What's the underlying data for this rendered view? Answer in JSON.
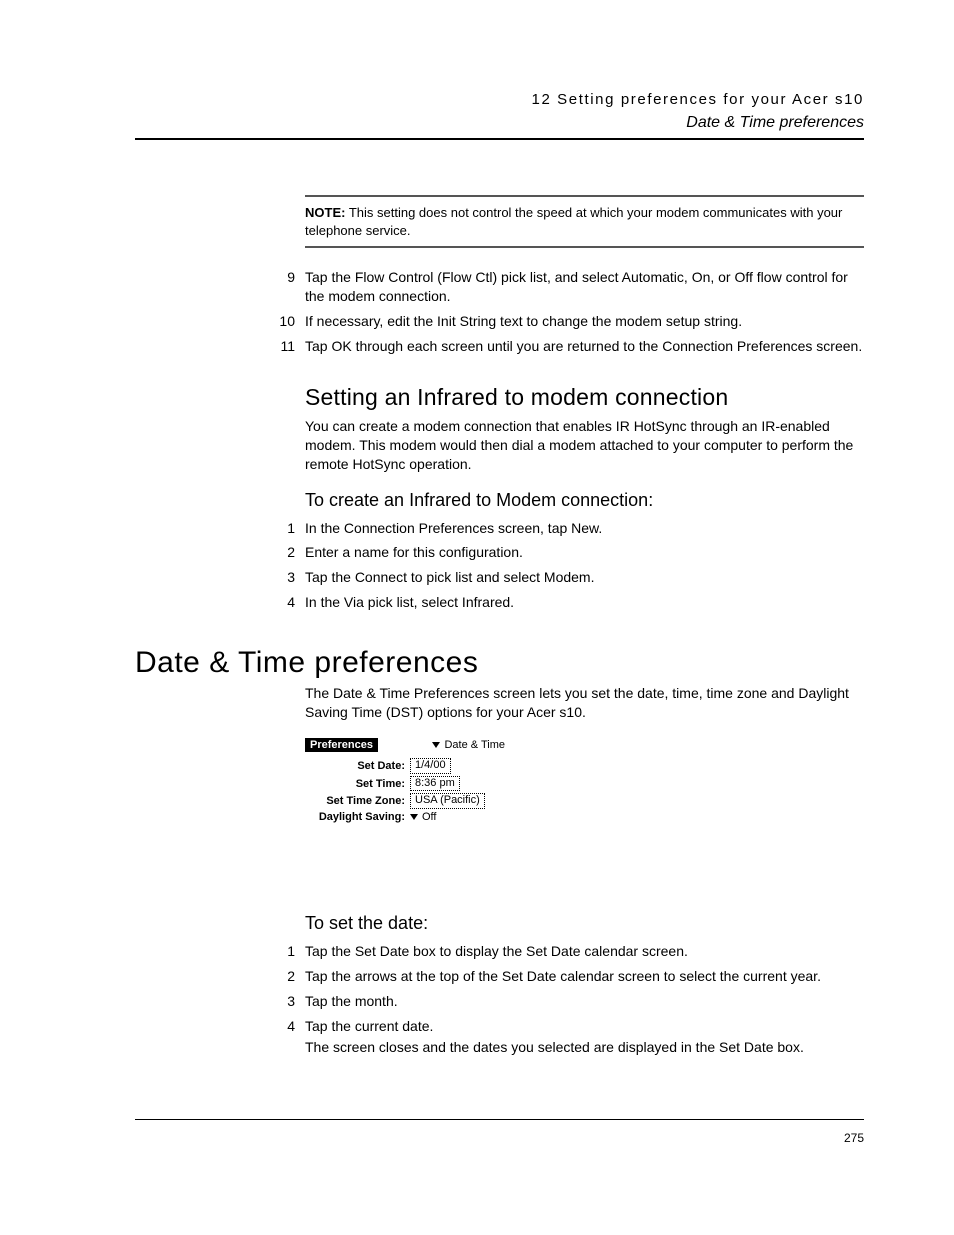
{
  "header": {
    "chapter": "12 Setting preferences for your Acer s10",
    "section": "Date & Time preferences"
  },
  "note": {
    "label": "NOTE:",
    "text": "This setting does not control the speed at which your modem communicates with your telephone service."
  },
  "steps_a": [
    {
      "n": "9",
      "text": "Tap the Flow Control (Flow Ctl) pick list, and select Automatic, On, or Off flow control for the modem connection."
    },
    {
      "n": "10",
      "text": "If necessary, edit the Init String text to change the modem setup string."
    },
    {
      "n": "11",
      "text": "Tap OK through each screen until you are returned to the Connection Preferences screen."
    }
  ],
  "sub1": {
    "title": "Setting an Infrared to modem connection",
    "para": "You can create a modem connection that enables IR HotSync through an IR-enabled modem. This modem would then dial a modem attached to your computer to perform the remote HotSync operation."
  },
  "proc1": {
    "title": "To create an Infrared to Modem connection:",
    "steps": [
      {
        "n": "1",
        "text": "In the Connection Preferences screen, tap New."
      },
      {
        "n": "2",
        "text": "Enter a name for this configuration."
      },
      {
        "n": "3",
        "text": "Tap the Connect to pick list and select Modem."
      },
      {
        "n": "4",
        "text": "In the Via pick list, select Infrared."
      }
    ]
  },
  "section2": {
    "title": "Date & Time preferences",
    "para": "The Date & Time Preferences screen lets you set the date, time, time zone and Daylight Saving Time (DST) options for your Acer s10."
  },
  "device": {
    "chip": "Preferences",
    "menu": "Date & Time",
    "rows": {
      "set_date_label": "Set Date:",
      "set_date_value": "1/4/00",
      "set_time_label": "Set Time:",
      "set_time_value": "8:36 pm",
      "set_tz_label": "Set Time Zone:",
      "set_tz_value": "USA (Pacific)",
      "dst_label": "Daylight Saving:",
      "dst_value": "Off"
    }
  },
  "proc2": {
    "title": "To set the date:",
    "steps": [
      {
        "n": "1",
        "text": "Tap the Set Date box to display the Set Date calendar screen."
      },
      {
        "n": "2",
        "text": "Tap the arrows at the top of the Set Date calendar screen to select the current year."
      },
      {
        "n": "3",
        "text": "Tap the month."
      },
      {
        "n": "4",
        "text": "Tap the current date.",
        "extra": "The screen closes and the dates you selected are displayed in the Set Date box."
      }
    ]
  },
  "page_number": "275"
}
